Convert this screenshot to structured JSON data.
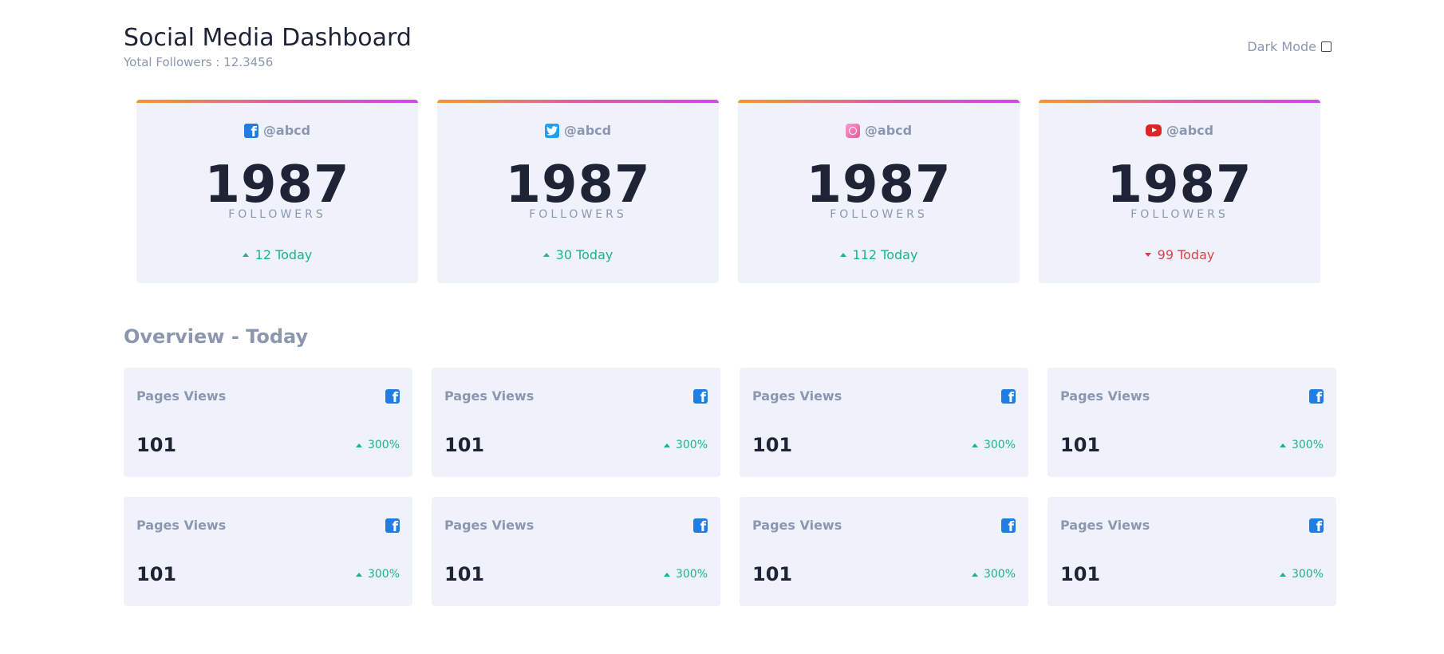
{
  "header": {
    "title": "Social Media Dashboard",
    "subtitle": "Yotal Followers : 12.3456",
    "dark_mode_label": "Dark Mode"
  },
  "follower_cards": [
    {
      "network_icon": "facebook-icon",
      "handle": "@abcd",
      "count": "1987",
      "label": "FOLLOWERS",
      "delta": "12 Today",
      "trend": "up"
    },
    {
      "network_icon": "twitter-icon",
      "handle": "@abcd",
      "count": "1987",
      "label": "FOLLOWERS",
      "delta": "30 Today",
      "trend": "up"
    },
    {
      "network_icon": "instagram-icon",
      "handle": "@abcd",
      "count": "1987",
      "label": "FOLLOWERS",
      "delta": "112 Today",
      "trend": "up"
    },
    {
      "network_icon": "youtube-icon",
      "handle": "@abcd",
      "count": "1987",
      "label": "FOLLOWERS",
      "delta": "99 Today",
      "trend": "down"
    }
  ],
  "overview": {
    "title": "Overview - Today",
    "cards": [
      {
        "label": "Pages Views",
        "icon": "facebook-icon",
        "value": "101",
        "change": "300%"
      },
      {
        "label": "Pages Views",
        "icon": "facebook-icon",
        "value": "101",
        "change": "300%"
      },
      {
        "label": "Pages Views",
        "icon": "facebook-icon",
        "value": "101",
        "change": "300%"
      },
      {
        "label": "Pages Views",
        "icon": "facebook-icon",
        "value": "101",
        "change": "300%"
      },
      {
        "label": "Pages Views",
        "icon": "facebook-icon",
        "value": "101",
        "change": "300%"
      },
      {
        "label": "Pages Views",
        "icon": "facebook-icon",
        "value": "101",
        "change": "300%"
      },
      {
        "label": "Pages Views",
        "icon": "facebook-icon",
        "value": "101",
        "change": "300%"
      },
      {
        "label": "Pages Views",
        "icon": "facebook-icon",
        "value": "101",
        "change": "300%"
      }
    ]
  },
  "colors": {
    "positive": "#1db489",
    "negative": "#dc414c",
    "card_bg": "#eff2fa",
    "muted_text": "#8b97b1",
    "primary_text": "#1e2436"
  }
}
